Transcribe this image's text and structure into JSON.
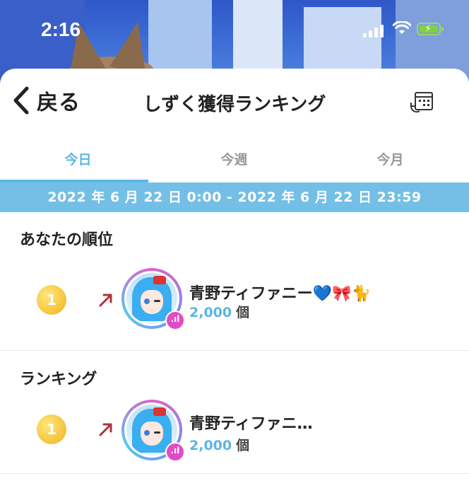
{
  "status_bar": {
    "time": "2:16"
  },
  "header": {
    "back_label": "戻る",
    "title": "しずく獲得ランキング"
  },
  "tabs": [
    {
      "label": "今日",
      "active": true
    },
    {
      "label": "今週",
      "active": false
    },
    {
      "label": "今月",
      "active": false
    }
  ],
  "date_range": "2022 年 6 月 22 日 0:00 - 2022 年 6 月 22 日 23:59",
  "my_rank": {
    "section_title": "あなたの順位",
    "rank": "1",
    "name": "青野ティファニー",
    "name_emojis": "💙🎀🐈",
    "count": "2,000",
    "unit": "個"
  },
  "ranking": {
    "section_title": "ランキング",
    "items": [
      {
        "rank": "1",
        "name": "青野ティファニ…",
        "count": "2,000",
        "unit": "個"
      }
    ]
  },
  "colors": {
    "accent": "#5bb6e6",
    "date_bar": "#73bfe6",
    "rank_gold": "#f4c23a",
    "trend_up": "#b0313a",
    "live_badge": "#e14bc6"
  },
  "icons": {
    "back": "chevron-left-icon",
    "history": "calendar-history-icon",
    "trend": "trend-up-arrow-icon"
  }
}
